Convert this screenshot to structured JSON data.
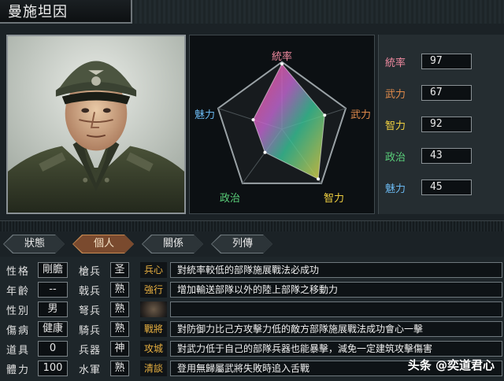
{
  "title": "曼施坦因",
  "radar": {
    "labels": [
      "統率",
      "武力",
      "智力",
      "政治",
      "魅力"
    ],
    "values": [
      97,
      67,
      92,
      43,
      45
    ]
  },
  "stats": [
    {
      "label": "統率",
      "value": "97",
      "color": "#f08aa0"
    },
    {
      "label": "武力",
      "value": "67",
      "color": "#e08a4a"
    },
    {
      "label": "智力",
      "value": "92",
      "color": "#f0d040"
    },
    {
      "label": "政治",
      "value": "43",
      "color": "#5ad07a"
    },
    {
      "label": "魅力",
      "value": "45",
      "color": "#6ab8f0"
    }
  ],
  "tabs": [
    {
      "label": "狀態",
      "active": false
    },
    {
      "label": "個人",
      "active": true
    },
    {
      "label": "關係",
      "active": false
    },
    {
      "label": "列傳",
      "active": false
    }
  ],
  "info": [
    {
      "label": "性格",
      "value": "剛膽",
      "unit": "槍兵",
      "apt": "圣",
      "skill": "兵心",
      "desc": "對統率較低的部隊施展戰法必成功"
    },
    {
      "label": "年齡",
      "value": "--",
      "unit": "戟兵",
      "apt": "熟",
      "skill": "強行",
      "desc": "增加輸送部隊以外的陸上部隊之移動力"
    },
    {
      "label": "性別",
      "value": "男",
      "unit": "弩兵",
      "apt": "熟",
      "skill": "",
      "desc": ""
    },
    {
      "label": "傷病",
      "value": "健康",
      "unit": "騎兵",
      "apt": "熟",
      "skill": "戰將",
      "desc": "對防御力比己方攻擊力低的敵方部隊施展戰法成功會心一擊"
    },
    {
      "label": "道具",
      "value": "0",
      "unit": "兵器",
      "apt": "神",
      "skill": "攻城",
      "desc": "對武力低于自己的部隊兵器也能暴擊，減免一定建筑攻擊傷害"
    },
    {
      "label": "體力",
      "value": "100",
      "unit": "水軍",
      "apt": "熟",
      "skill": "清談",
      "desc": "登用無歸屬武將失敗時追入舌戰"
    }
  ],
  "watermark": "头条 @奕道君心"
}
